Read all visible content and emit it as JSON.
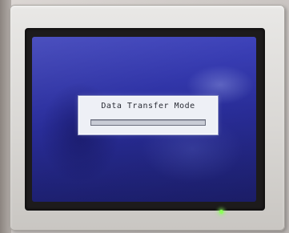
{
  "device": {
    "type": "HMI touch panel"
  },
  "dialog": {
    "title": "Data Transfer Mode",
    "progress": 0
  },
  "indicator": {
    "icon": "status-led-icon",
    "color": "#8cff5a"
  },
  "colors": {
    "screen": "#2b2f9f",
    "dialog": "#eef0f6",
    "bezel": "#d9d7d4"
  }
}
